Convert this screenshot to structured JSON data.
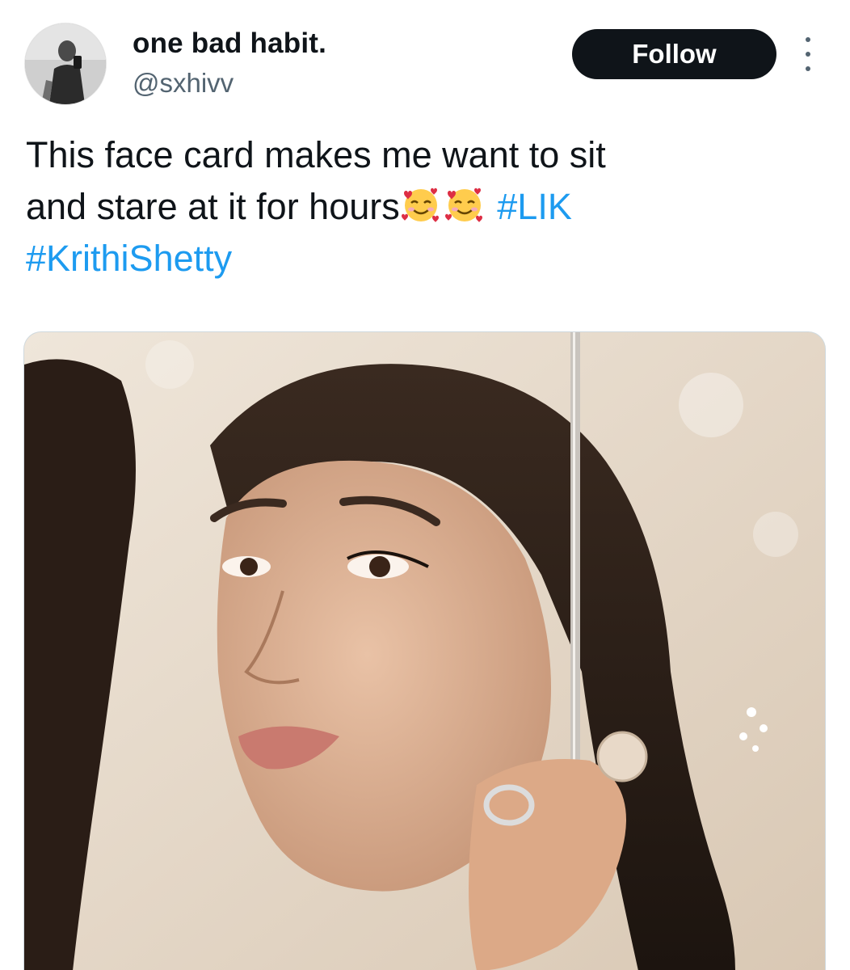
{
  "author": {
    "display_name": "one bad habit.",
    "handle": "@sxhivv"
  },
  "actions": {
    "follow_label": "Follow",
    "more_icon": "more-vertical-icon"
  },
  "tweet": {
    "text_line1": "This face card makes me want to sit",
    "text_line2_prefix": "and stare at it for hours",
    "emojis": [
      "smiling-face-with-hearts",
      "smiling-face-with-hearts"
    ],
    "hashtag1": "#LIK",
    "hashtag2": "#KrithiShetty"
  },
  "colors": {
    "hashtag": "#1d9bf0",
    "follow_bg": "#0f1419",
    "handle": "#536471"
  }
}
